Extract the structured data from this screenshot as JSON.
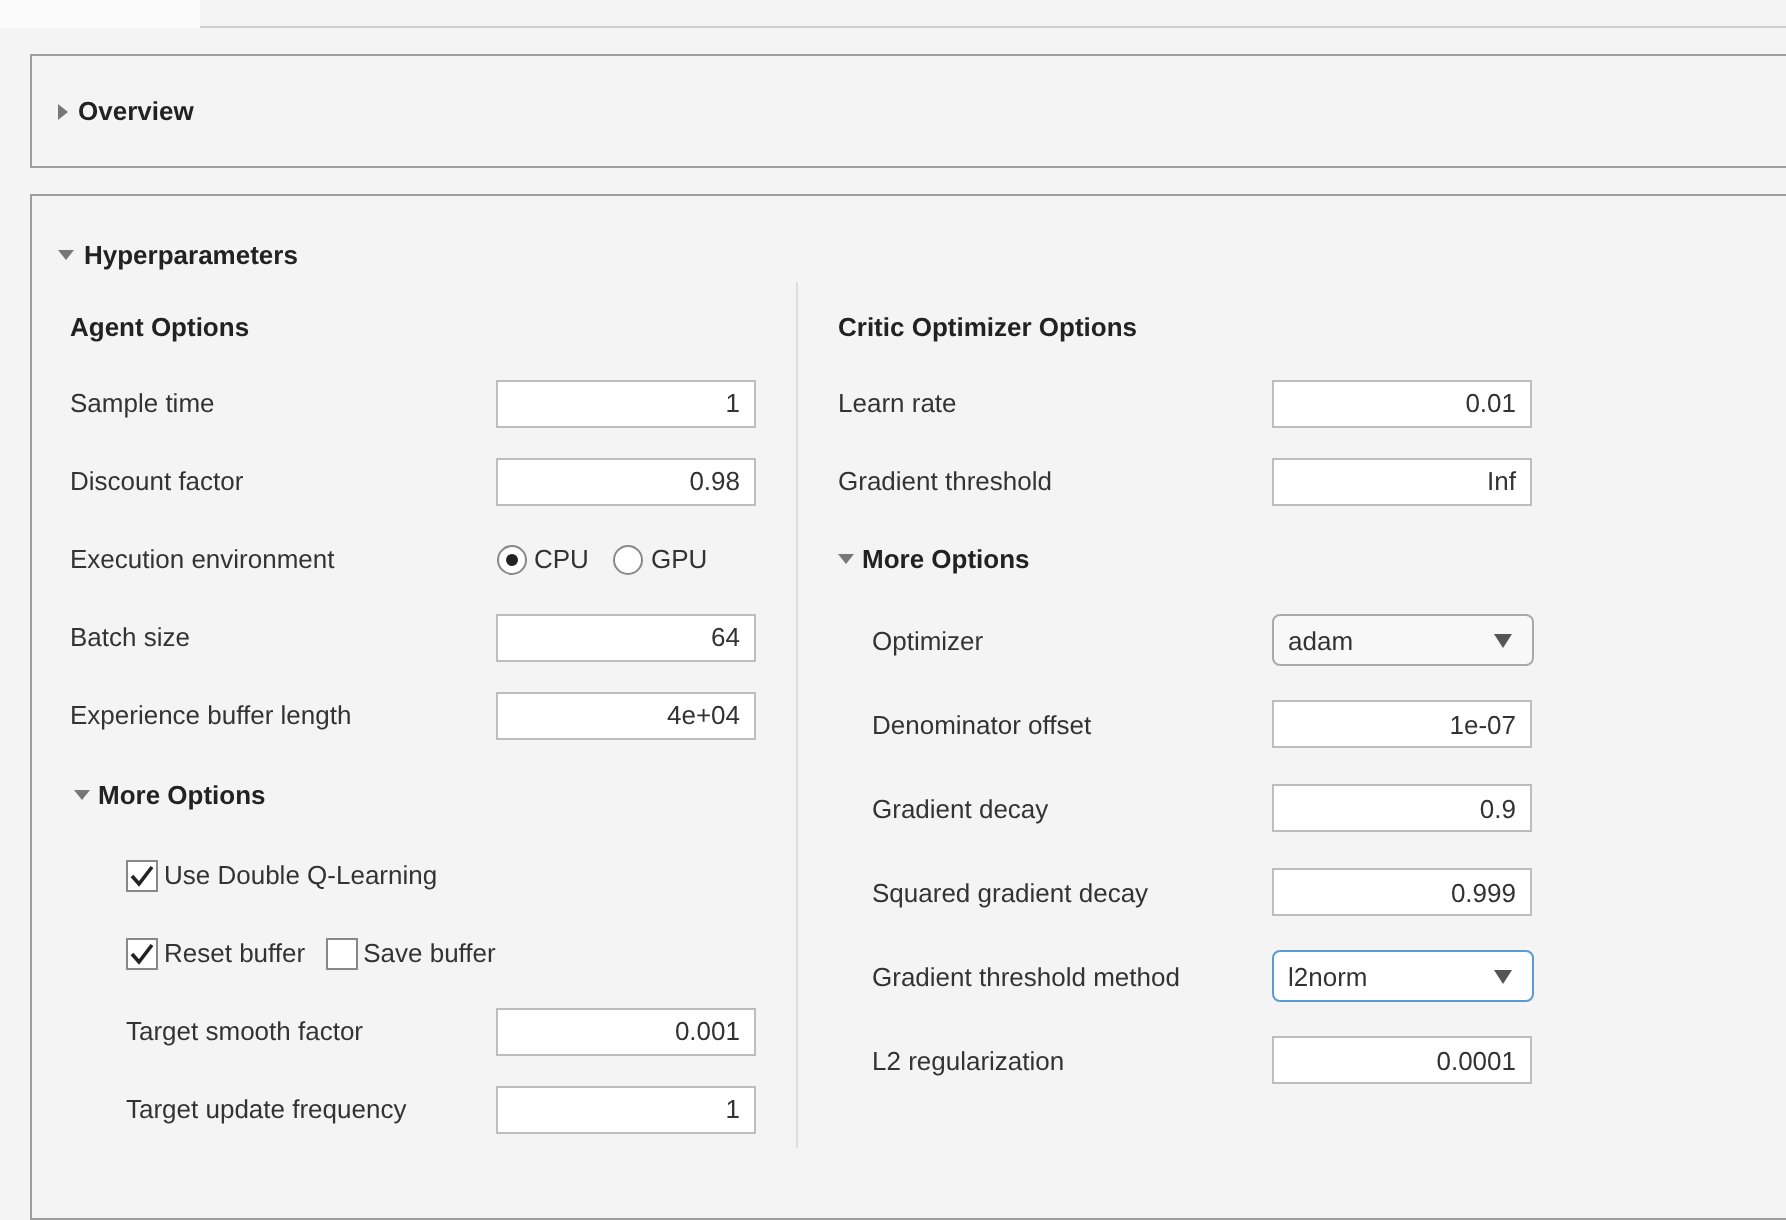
{
  "sections": [
    {
      "title": "Overview",
      "expanded": false
    },
    {
      "title": "Hyperparameters",
      "expanded": true,
      "columns": [
        {
          "heading": "Agent Options",
          "items": [
            {
              "kind": "field",
              "label": "Sample time",
              "value": "1"
            },
            {
              "kind": "field",
              "label": "Discount factor",
              "value": "0.98"
            },
            {
              "kind": "radio",
              "label": "Execution environment",
              "options": [
                {
                  "label": "CPU",
                  "selected": true
                },
                {
                  "label": "GPU",
                  "selected": false
                }
              ]
            },
            {
              "kind": "field",
              "label": "Batch size",
              "value": "64"
            },
            {
              "kind": "field",
              "label": "Experience buffer length",
              "value": "4e+04"
            },
            {
              "kind": "group",
              "title": "More Options",
              "expanded": true,
              "items": [
                {
                  "kind": "checks",
                  "options": [
                    {
                      "label": "Use Double Q-Learning",
                      "checked": true
                    }
                  ]
                },
                {
                  "kind": "checks",
                  "options": [
                    {
                      "label": "Reset buffer",
                      "checked": true
                    },
                    {
                      "label": "Save buffer",
                      "checked": false
                    }
                  ]
                },
                {
                  "kind": "field",
                  "label": "Target smooth factor",
                  "value": "0.001"
                },
                {
                  "kind": "field",
                  "label": "Target update frequency",
                  "value": "1"
                }
              ]
            }
          ]
        },
        {
          "heading": "Critic Optimizer Options",
          "items": [
            {
              "kind": "field",
              "label": "Learn rate",
              "value": "0.01"
            },
            {
              "kind": "field",
              "label": "Gradient threshold",
              "value": "Inf"
            },
            {
              "kind": "group",
              "title": "More Options",
              "expanded": true,
              "items": [
                {
                  "kind": "dropdown",
                  "label": "Optimizer",
                  "value": "adam",
                  "focused": false
                },
                {
                  "kind": "field",
                  "label": "Denominator offset",
                  "value": "1e-07"
                },
                {
                  "kind": "field",
                  "label": "Gradient decay",
                  "value": "0.9"
                },
                {
                  "kind": "field",
                  "label": "Squared gradient decay",
                  "value": "0.999"
                },
                {
                  "kind": "dropdown",
                  "label": "Gradient threshold method",
                  "value": "l2norm",
                  "focused": true
                },
                {
                  "kind": "field",
                  "label": "L2 regularization",
                  "value": "0.0001"
                }
              ]
            }
          ]
        }
      ]
    }
  ]
}
